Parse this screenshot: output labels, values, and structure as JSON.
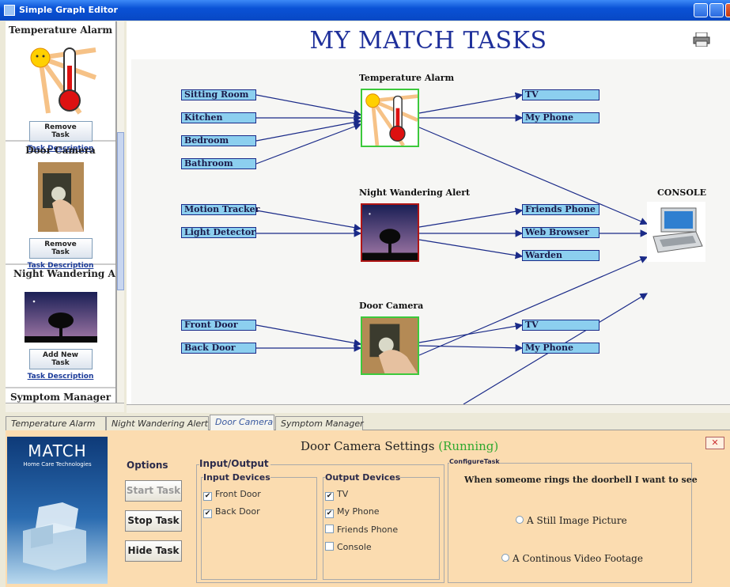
{
  "window": {
    "title": "Simple Graph Editor"
  },
  "sidebar": {
    "tasks": [
      {
        "title": "Temperature Alarm",
        "button": "Remove Task",
        "link": "Task Description"
      },
      {
        "title": "Door Camera",
        "button": "Remove Task",
        "link": "Task Description"
      },
      {
        "title": "Night Wandering Alert",
        "button": "Add New Task",
        "link": "Task Description"
      },
      {
        "title": "Symptom Manager"
      }
    ]
  },
  "canvas": {
    "title": "MY MATCH TASKS",
    "task_labels": {
      "temperature": "Temperature Alarm",
      "night": "Night Wandering Alert",
      "door": "Door Camera",
      "console": "CONSOLE"
    },
    "inputs": {
      "temperature": [
        "Sitting Room",
        "Kitchen",
        "Bedroom",
        "Bathroom"
      ],
      "night": [
        "Motion Tracker",
        "Light Detector"
      ],
      "door": [
        "Front Door",
        "Back Door"
      ]
    },
    "outputs": {
      "temperature": [
        "TV",
        "My Phone"
      ],
      "night": [
        "Friends Phone",
        "Web Browser",
        "Warden"
      ],
      "door": [
        "TV",
        "My Phone"
      ]
    }
  },
  "tabs": [
    "Temperature Alarm",
    "Night Wandering Alert",
    "Door Camera",
    "Symptom Manager"
  ],
  "active_tab": "Door Camera",
  "logo": {
    "name": "MATCH",
    "tagline": "Home Care Technologies"
  },
  "settings": {
    "title": "Door Camera Settings",
    "status": "(Running)",
    "close": "✕",
    "options_label": "Options",
    "buttons": {
      "start": "Start Task",
      "stop": "Stop Task",
      "hide": "Hide Task"
    },
    "io_label": "Input/Output",
    "input_devices_label": "Input Devices",
    "input_devices": [
      {
        "label": "Front Door",
        "checked": true
      },
      {
        "label": "Back Door",
        "checked": true
      }
    ],
    "output_devices_label": "Output Devices",
    "output_devices": [
      {
        "label": "TV",
        "checked": true
      },
      {
        "label": "My Phone",
        "checked": true
      },
      {
        "label": "Friends Phone",
        "checked": false
      },
      {
        "label": "Console",
        "checked": false
      }
    ],
    "configure_label": "ConfigureTask",
    "configure_text": "When someome rings the doorbell I want to see",
    "radio_options": [
      "A Still Image Picture",
      "A Continous Video Footage"
    ]
  },
  "colors": {
    "title_blue": "#1e2f9a",
    "node_fill": "#8ccfef",
    "panel": "#fbdcb0",
    "running": "#2fa82f"
  }
}
